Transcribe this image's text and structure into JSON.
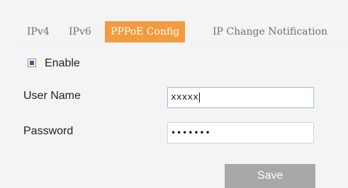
{
  "tabs": [
    {
      "label": "IPv4"
    },
    {
      "label": "IPv6"
    },
    {
      "label": "PPPoE Config",
      "active": true
    },
    {
      "label": "IP Change Notification"
    }
  ],
  "colors": {
    "active_tab": "#f39b3e",
    "save_button": "#a8a8a8",
    "background": "#f4f4f4"
  },
  "form": {
    "enable": {
      "label": "Enable",
      "checked": true
    },
    "username": {
      "label": "User Name",
      "value": "xxxxx"
    },
    "password": {
      "label": "Password",
      "value": "•••••••"
    }
  },
  "actions": {
    "save_label": "Save"
  }
}
